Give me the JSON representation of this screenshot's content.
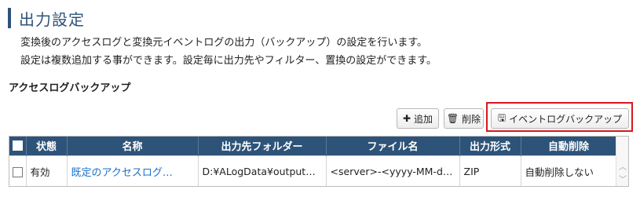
{
  "page": {
    "title": "出力設定",
    "description_line1": "変換後のアクセスログと変換元イベントログの出力（バックアップ）の設定を行います。",
    "description_line2": "設定は複数追加する事ができます。設定毎に出力先やフィルター、置換の設定ができます。"
  },
  "section": {
    "title": "アクセスログバックアップ"
  },
  "toolbar": {
    "add_label": "追加",
    "delete_label": "削除",
    "backup_label": "イベントログバックアップ"
  },
  "table": {
    "headers": [
      "状態",
      "名称",
      "出力先フォルダー",
      "ファイル名",
      "出力形式",
      "自動削除"
    ],
    "rows": [
      {
        "status": "有効",
        "name": "既定のアクセスログ…",
        "folder": "D:¥ALogData¥output¥…",
        "filename": "<server>-<yyyy-MM-d…",
        "format": "ZIP",
        "auto_delete": "自動削除しない"
      }
    ]
  },
  "colors": {
    "header_bg": "#2e5379",
    "link": "#1a6fc9",
    "highlight": "#d9161d"
  },
  "icons": {
    "add": "plus-icon",
    "delete": "trash-icon",
    "backup": "save-icon"
  }
}
